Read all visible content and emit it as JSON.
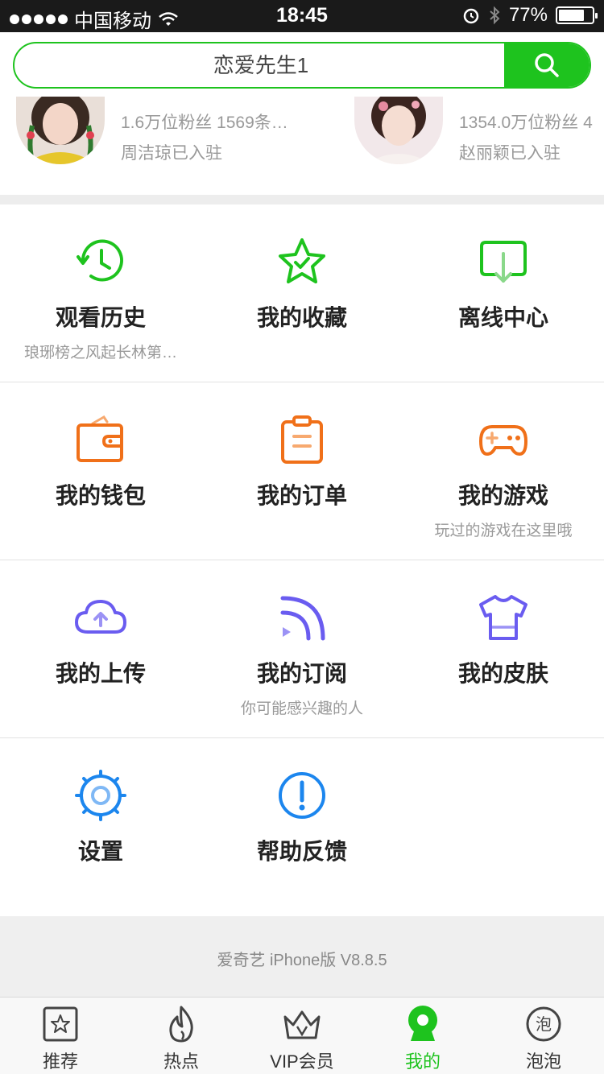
{
  "status_bar": {
    "carrier": "中国移动",
    "time": "18:45",
    "battery_percent": "77%",
    "battery_level": 0.77
  },
  "search": {
    "query": "恋爱先生1",
    "icon": "search-icon"
  },
  "stars": [
    {
      "line1": "1.6万位粉丝 1569条…",
      "line2": "周洁琼已入驻"
    },
    {
      "line1": "1354.0万位粉丝 4",
      "line2": "赵丽颖已入驻"
    }
  ],
  "grid": {
    "history": {
      "label": "观看历史",
      "sub": "琅琊榜之风起长林第…",
      "icon": "clock-history-icon"
    },
    "favorites": {
      "label": "我的收藏",
      "sub": "",
      "icon": "star-icon"
    },
    "offline": {
      "label": "离线中心",
      "sub": "",
      "icon": "download-icon"
    },
    "wallet": {
      "label": "我的钱包",
      "sub": "",
      "icon": "wallet-icon"
    },
    "orders": {
      "label": "我的订单",
      "sub": "",
      "icon": "clipboard-icon"
    },
    "games": {
      "label": "我的游戏",
      "sub": "玩过的游戏在这里哦",
      "icon": "gamepad-icon"
    },
    "upload": {
      "label": "我的上传",
      "sub": "",
      "icon": "cloud-upload-icon"
    },
    "subscribe": {
      "label": "我的订阅",
      "sub": "你可能感兴趣的人",
      "icon": "rss-icon"
    },
    "skin": {
      "label": "我的皮肤",
      "sub": "",
      "icon": "tshirt-icon"
    },
    "settings": {
      "label": "设置",
      "sub": "",
      "icon": "gear-icon"
    },
    "help": {
      "label": "帮助反馈",
      "sub": "",
      "icon": "exclamation-icon"
    }
  },
  "footer": {
    "version": "爱奇艺 iPhone版 V8.8.5"
  },
  "tabbar": [
    {
      "label": "推荐",
      "icon": "star-box-icon"
    },
    {
      "label": "热点",
      "icon": "flame-icon"
    },
    {
      "label": "VIP会员",
      "icon": "crown-icon"
    },
    {
      "label": "我的",
      "icon": "profile-icon",
      "active": true
    },
    {
      "label": "泡泡",
      "icon": "bubble-icon"
    }
  ],
  "colors": {
    "accent": "#1ec31e",
    "orange": "#f07019",
    "purple": "#6a5cf0",
    "blue": "#1c86ee"
  }
}
